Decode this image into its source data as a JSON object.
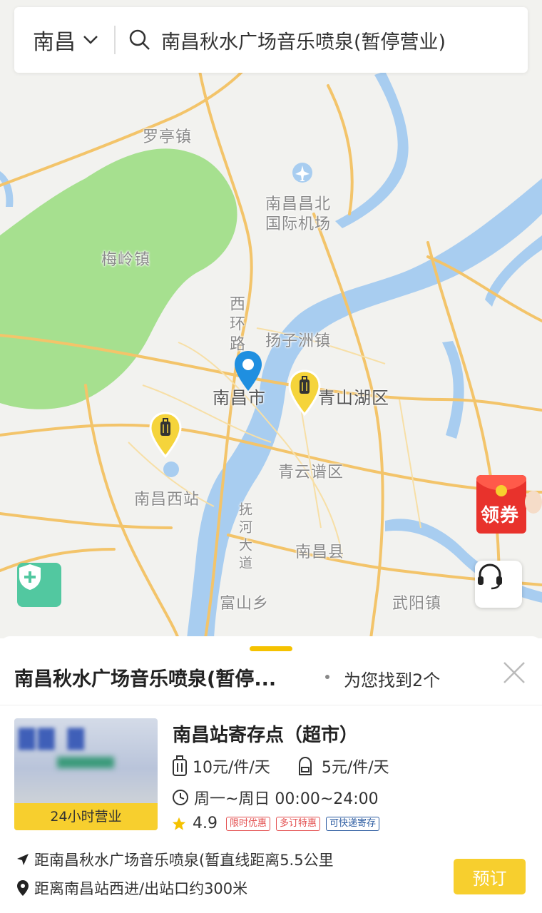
{
  "search": {
    "city": "南昌",
    "query": "南昌秋水广场音乐喷泉(暂停营业)"
  },
  "map": {
    "labels": {
      "luoting": "罗亭镇",
      "meiling": "梅岭镇",
      "airport_l1": "南昌昌北",
      "airport_l2": "国际机场",
      "xihuan": "西环路",
      "yangzizhou": "扬子洲镇",
      "nanchang_city": "南昌市",
      "qingshanhu": "青山湖区",
      "qingyunpu": "青云谱区",
      "west_station": "南昌西站",
      "nanchang_county": "南昌县",
      "fuhe": "抚河大道",
      "fushan": "富山乡",
      "wuyang": "武阳镇"
    },
    "coupon_label": "领券"
  },
  "sheet": {
    "title": "南昌秋水广场音乐喷泉(暂停...",
    "result_text": "为您找到2个",
    "item": {
      "badge": "24小时营业",
      "name": "南昌站寄存点（超市）",
      "price_luggage": "10元/件/天",
      "price_backpack": "5元/件/天",
      "hours": "周一~周日 00:00~24:00",
      "rating": "4.9",
      "tags": [
        "限时优惠",
        "多订特惠",
        "可快递寄存"
      ],
      "distance": "距南昌秋水广场音乐喷泉(暂直线距离5.5公里",
      "address": "距离南昌站西进/出站口约300米",
      "book_label": "预订"
    }
  },
  "colors": {
    "accent": "#f7cf2e",
    "pin_blue": "#1f8fe0",
    "river": "#a8cdf0",
    "park": "#9fdc8a",
    "road": "#f3c46a"
  }
}
